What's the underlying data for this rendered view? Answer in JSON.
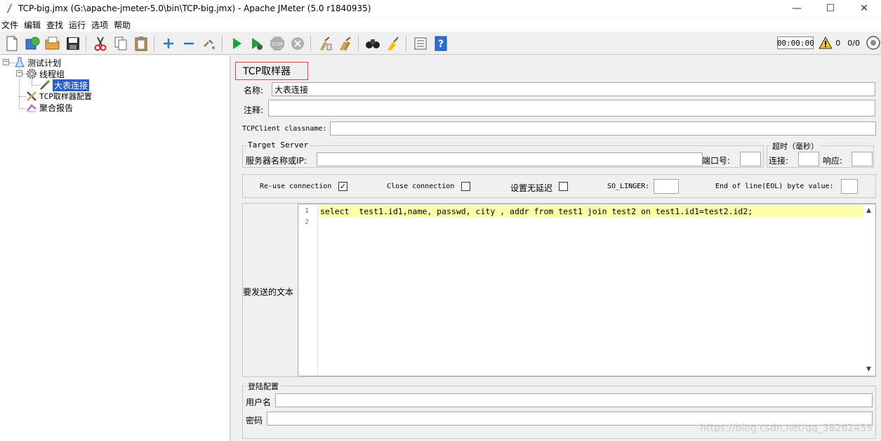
{
  "window": {
    "title": "TCP-big.jmx (G:\\apache-jmeter-5.0\\bin\\TCP-big.jmx) - Apache JMeter (5.0 r1840935)",
    "minimize": "—",
    "maximize": "☐",
    "close": "✕"
  },
  "menu": [
    "文件",
    "编辑",
    "查找",
    "运行",
    "选项",
    "帮助"
  ],
  "toolbar": {
    "timer": "00:00:00",
    "warning_count": "0",
    "threads_ratio": "0/0"
  },
  "tree": {
    "test_plan": "测试计划",
    "thread_group": "线程组",
    "sampler": "大表连接",
    "config": "TCP取样器配置",
    "report": "聚合报告"
  },
  "sampler": {
    "panel_title": "TCP取样器",
    "name_label": "名称:",
    "name_value": "大表连接",
    "comment_label": "注释:",
    "comment_value": "",
    "classname_label": "TCPClient classname:",
    "classname_value": "",
    "target_server": {
      "title": "Target Server",
      "server_label": "服务器名称或IP:",
      "server_value": "",
      "port_label": "端口号:",
      "port_value": ""
    },
    "timeout": {
      "title": "超时（毫秒）",
      "connect_label": "连接:",
      "connect_value": "",
      "response_label": "响应:",
      "response_value": ""
    },
    "options": {
      "reuse_label": "Re-use connection",
      "reuse_checked": "✓",
      "close_label": "Close connection",
      "nodelay_label": "设置无延迟",
      "linger_label": "SO_LINGER:",
      "linger_value": "",
      "eol_label": "End of line(EOL) byte value:",
      "eol_value": ""
    },
    "text_label": "要发送的文本",
    "text_lines": [
      "1",
      "2"
    ],
    "text_content": "select  test1.id1,name, passwd, city , addr from test1 join test2 on test1.id1=test2.id2;",
    "login": {
      "title": "登陆配置",
      "user_label": "用户名",
      "user_value": "",
      "password_label": "密码",
      "password_value": ""
    }
  },
  "watermark": "https://blog.csdn.net/qq_38262455"
}
